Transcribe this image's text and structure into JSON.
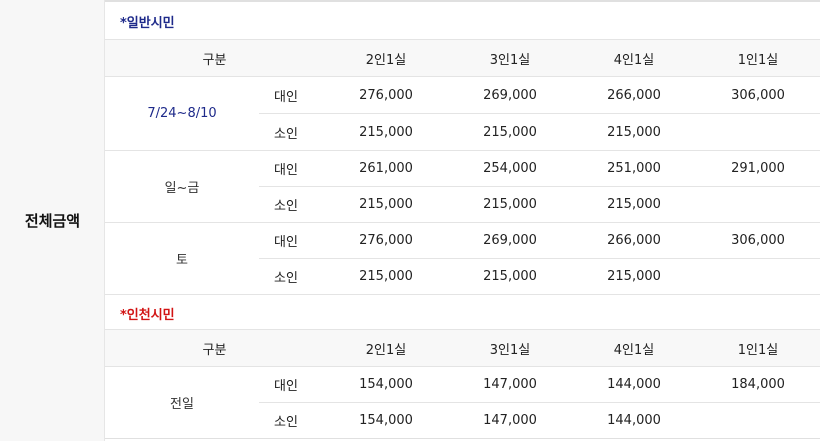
{
  "left_title": "전체금액",
  "sections": [
    {
      "label": "*일반시민",
      "header": [
        "구분",
        "2인1실",
        "3인1실",
        "4인1실",
        "1인1실"
      ],
      "groups": [
        {
          "period": "7/24~8/10",
          "rows": [
            {
              "type": "대인",
              "values": [
                "276,000",
                "269,000",
                "266,000",
                "306,000"
              ]
            },
            {
              "type": "소인",
              "values": [
                "215,000",
                "215,000",
                "215,000",
                ""
              ]
            }
          ]
        },
        {
          "period": "일~금",
          "rows": [
            {
              "type": "대인",
              "values": [
                "261,000",
                "254,000",
                "251,000",
                "291,000"
              ]
            },
            {
              "type": "소인",
              "values": [
                "215,000",
                "215,000",
                "215,000",
                ""
              ]
            }
          ]
        },
        {
          "period": "토",
          "rows": [
            {
              "type": "대인",
              "values": [
                "276,000",
                "269,000",
                "266,000",
                "306,000"
              ]
            },
            {
              "type": "소인",
              "values": [
                "215,000",
                "215,000",
                "215,000",
                ""
              ]
            }
          ]
        }
      ]
    },
    {
      "label": "*인천시민",
      "header": [
        "구분",
        "2인1실",
        "3인1실",
        "4인1실",
        "1인1실"
      ],
      "groups": [
        {
          "period": "전일",
          "rows": [
            {
              "type": "대인",
              "values": [
                "154,000",
                "147,000",
                "144,000",
                "184,000"
              ]
            },
            {
              "type": "소인",
              "values": [
                "154,000",
                "147,000",
                "144,000",
                ""
              ]
            }
          ]
        }
      ]
    }
  ]
}
